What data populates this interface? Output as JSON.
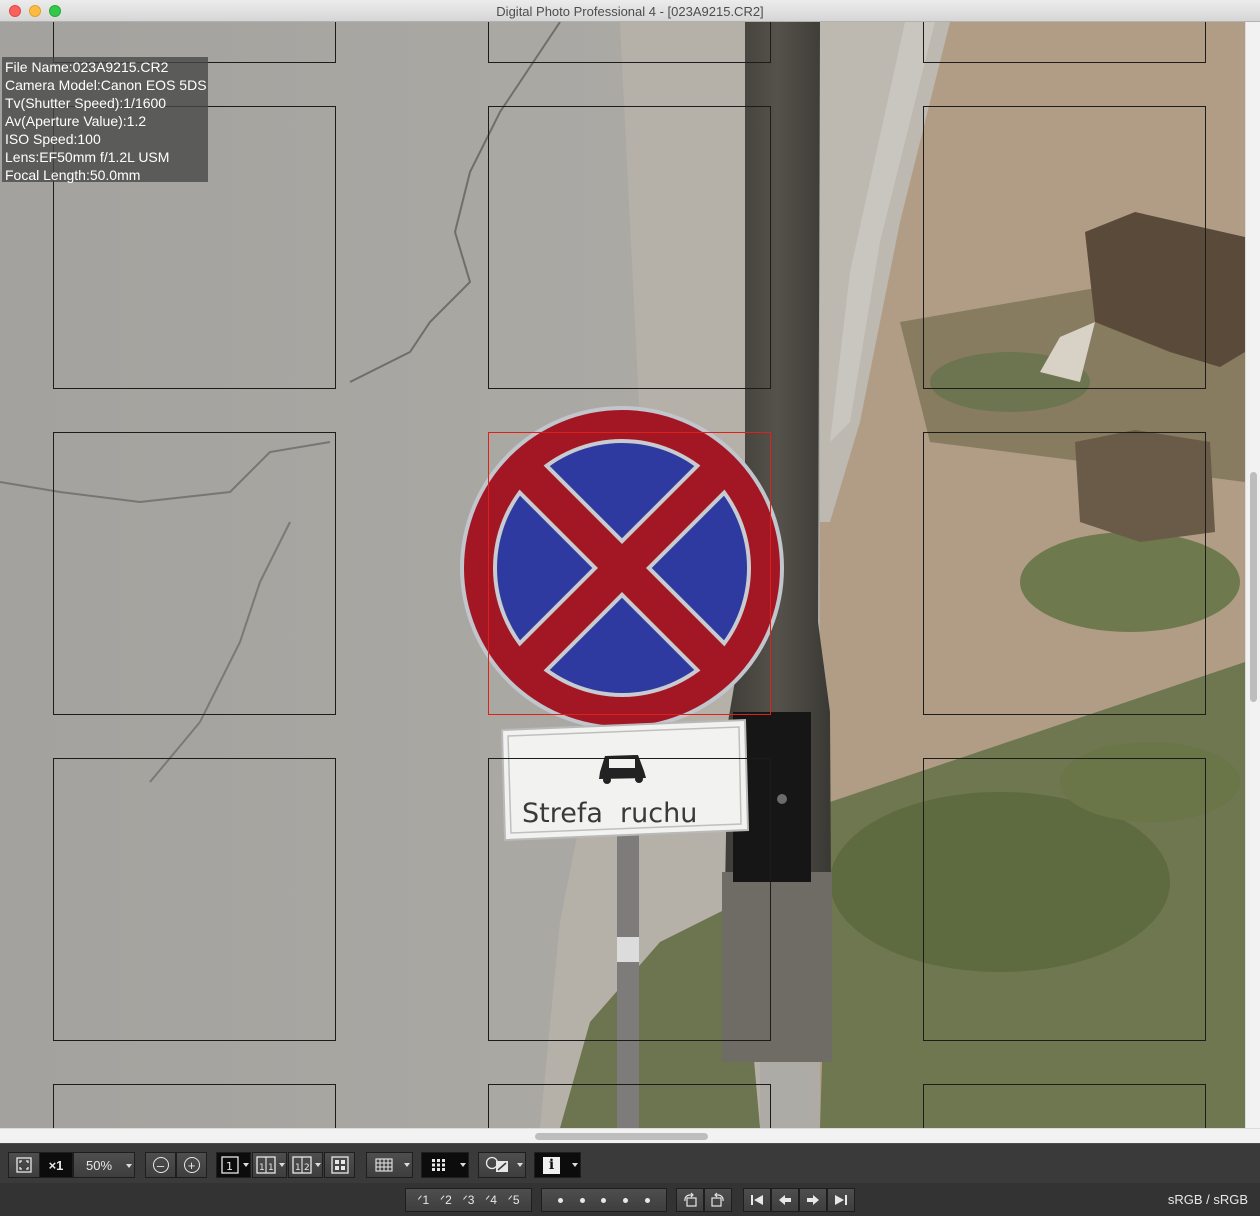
{
  "window": {
    "title": "Digital Photo Professional 4 - [023A9215.CR2]"
  },
  "photo": {
    "sign_text": "Strefa  ruchu"
  },
  "info_overlay": {
    "lines": [
      "File Name:023A9215.CR2",
      "Camera Model:Canon EOS 5DS",
      "Tv(Shutter Speed):1/1600",
      "Av(Aperture Value):1.2",
      "ISO Speed:100",
      "Lens:EF50mm f/1.2L USM",
      "Focal Length:50.0mm"
    ]
  },
  "toolbar": {
    "zoom_1x_label": "×1",
    "zoom_value": "50%",
    "ratings": [
      "1",
      "2",
      "3",
      "4",
      "5"
    ],
    "info_button_label": "i",
    "colorspace": "sRGB / sRGB"
  },
  "colors": {
    "af_active": "#e0201a",
    "af_inactive": "#1c1c1c"
  }
}
